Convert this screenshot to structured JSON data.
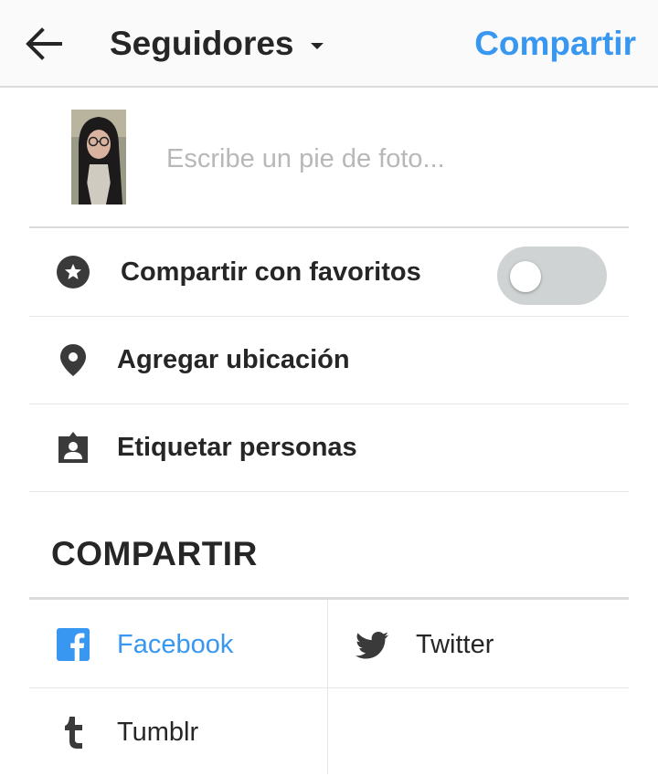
{
  "header": {
    "back_icon": "arrow-left-icon",
    "title": "Seguidores",
    "share_label": "Compartir",
    "accent_color": "#3897f0"
  },
  "caption": {
    "placeholder": "Escribe un pie de foto...",
    "value": ""
  },
  "options": {
    "favorites": {
      "label": "Compartir con favoritos",
      "icon": "star-circle-icon",
      "enabled": false
    },
    "location": {
      "label": "Agregar ubicación",
      "icon": "location-pin-icon"
    },
    "tag": {
      "label": "Etiquetar personas",
      "icon": "tag-person-icon"
    }
  },
  "share": {
    "heading": "COMPARTIR",
    "targets": [
      {
        "label": "Facebook",
        "icon": "facebook-icon",
        "active": true,
        "color": "#3897f0"
      },
      {
        "label": "Twitter",
        "icon": "twitter-icon",
        "active": false
      },
      {
        "label": "Tumblr",
        "icon": "tumblr-icon",
        "active": false
      }
    ]
  }
}
